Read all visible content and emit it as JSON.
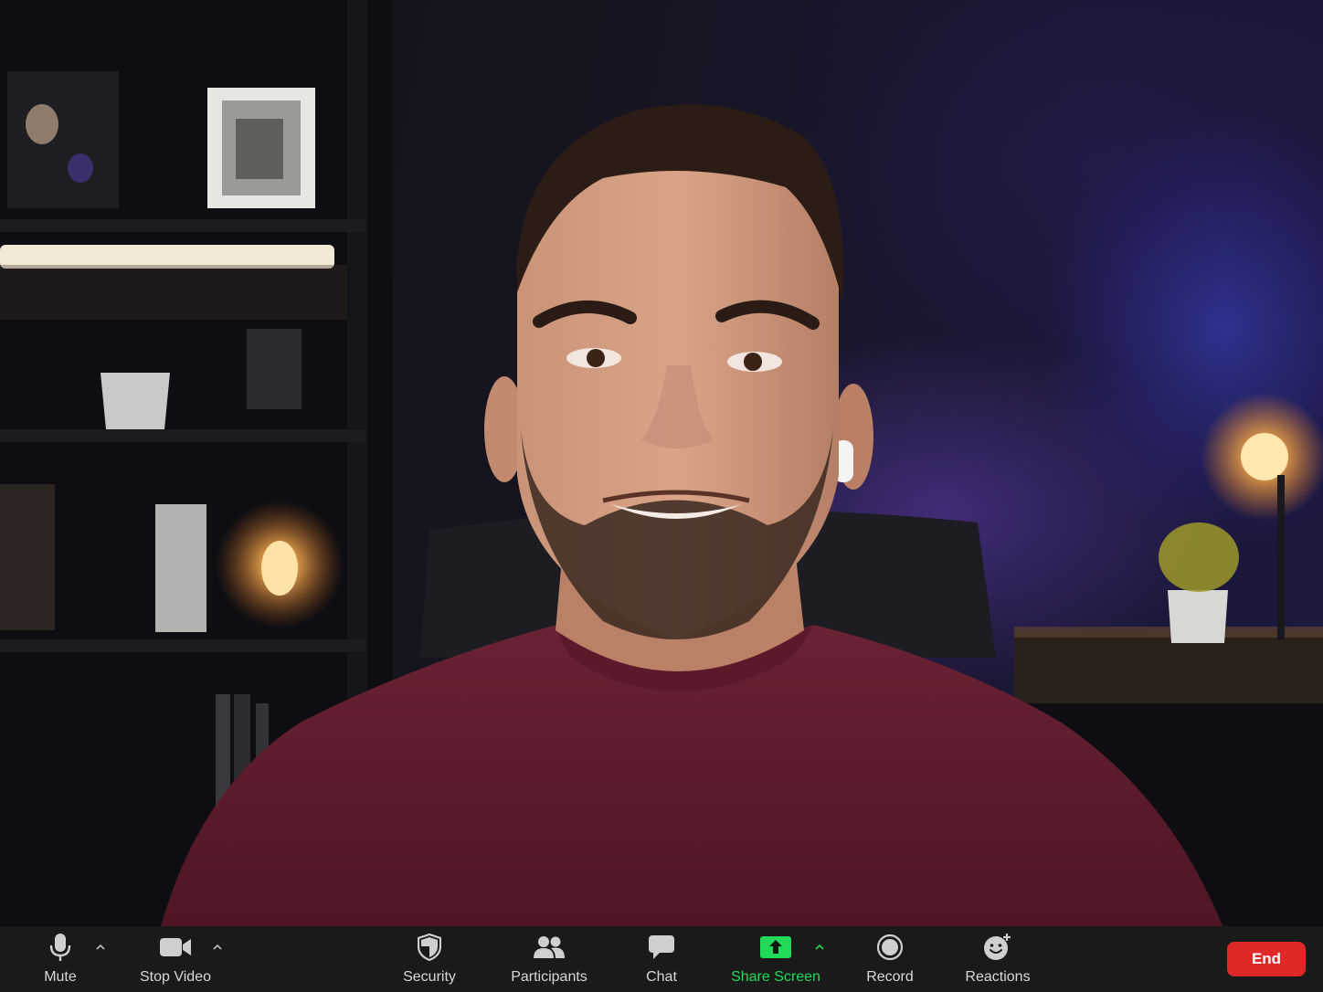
{
  "toolbar": {
    "mute_label": "Mute",
    "stop_video_label": "Stop Video",
    "security_label": "Security",
    "participants_label": "Participants",
    "chat_label": "Chat",
    "share_screen_label": "Share Screen",
    "record_label": "Record",
    "reactions_label": "Reactions",
    "end_label": "End"
  },
  "colors": {
    "toolbar_bg": "#1a1a1a",
    "share_green": "#23d959",
    "end_red": "#e02828",
    "label_gray": "#d8d8d8"
  },
  "icons": {
    "mute": "microphone-icon",
    "stop_video": "video-camera-icon",
    "security": "shield-icon",
    "participants": "participants-icon",
    "chat": "chat-bubble-icon",
    "share_screen": "share-screen-arrow-icon",
    "record": "record-icon",
    "reactions": "smiley-plus-icon",
    "menu_caret": "chevron-up-icon"
  }
}
